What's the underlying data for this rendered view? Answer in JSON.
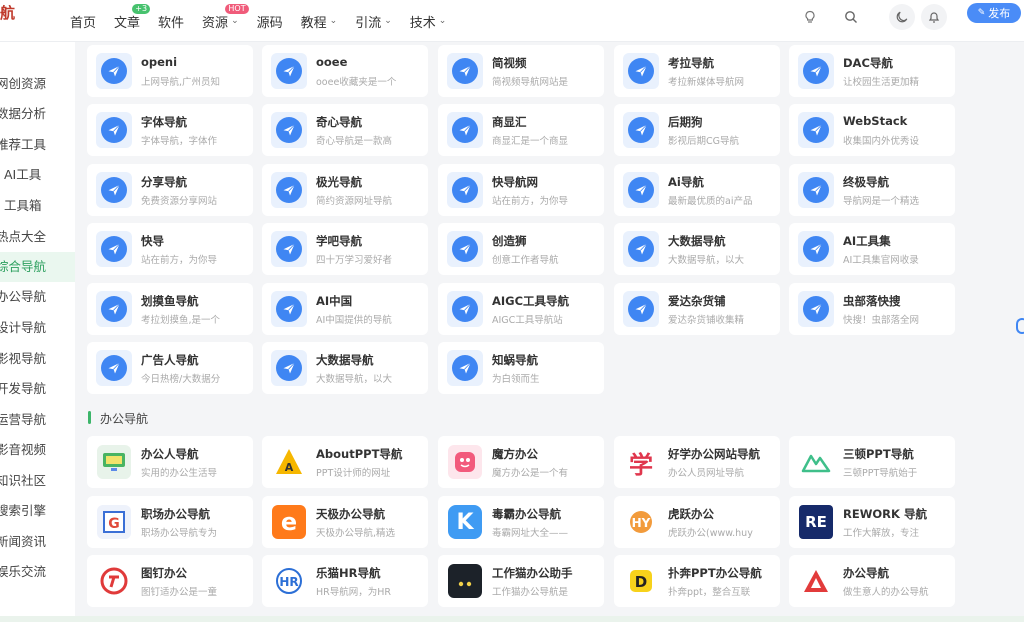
{
  "header": {
    "logo": "航",
    "nav": [
      {
        "label": "首页",
        "chevron": false,
        "badge": ""
      },
      {
        "label": "文章",
        "chevron": false,
        "badge": "+3"
      },
      {
        "label": "软件",
        "chevron": false,
        "badge": ""
      },
      {
        "label": "资源",
        "chevron": true,
        "badge": "HOT"
      },
      {
        "label": "源码",
        "chevron": false,
        "badge": ""
      },
      {
        "label": "教程",
        "chevron": true,
        "badge": ""
      },
      {
        "label": "引流",
        "chevron": true,
        "badge": ""
      },
      {
        "label": "技术",
        "chevron": true,
        "badge": ""
      }
    ],
    "publish_label": "发布",
    "icons": [
      "lightbulb-icon",
      "search-icon",
      "moon-icon",
      "bell-icon"
    ]
  },
  "sidebar": {
    "items": [
      {
        "label": "网创资源",
        "active": false
      },
      {
        "label": "数据分析",
        "active": false
      },
      {
        "label": "推荐工具",
        "active": false
      },
      {
        "label": "AI工具",
        "active": false
      },
      {
        "label": "工具箱",
        "active": false
      },
      {
        "label": "热点大全",
        "active": false
      },
      {
        "label": "综合导航",
        "active": true
      },
      {
        "label": "办公导航",
        "active": false
      },
      {
        "label": "设计导航",
        "active": false
      },
      {
        "label": "影视导航",
        "active": false
      },
      {
        "label": "开发导航",
        "active": false
      },
      {
        "label": "运营导航",
        "active": false
      },
      {
        "label": "影音视频",
        "active": false
      },
      {
        "label": "知识社区",
        "active": false
      },
      {
        "label": "搜索引擎",
        "active": false
      },
      {
        "label": "新闻资讯",
        "active": false
      },
      {
        "label": "娱乐交流",
        "active": false
      }
    ]
  },
  "nav_cards": [
    {
      "title": "openi",
      "desc": "上网导航,广州员知"
    },
    {
      "title": "ooee",
      "desc": "ooee收藏夹是一个"
    },
    {
      "title": "简视频",
      "desc": "简视频导航网站是"
    },
    {
      "title": "考拉导航",
      "desc": "考拉新媒体导航网"
    },
    {
      "title": "DAC导航",
      "desc": "让校园生活更加精"
    },
    {
      "title": "字体导航",
      "desc": "字体导航，字体作"
    },
    {
      "title": "奇心导航",
      "desc": "奇心导航是一款高"
    },
    {
      "title": "商显汇",
      "desc": "商显汇是一个商显"
    },
    {
      "title": "后期狗",
      "desc": "影视后期CG导航"
    },
    {
      "title": "WebStack",
      "desc": "收集国内外优秀设"
    },
    {
      "title": "分享导航",
      "desc": "免费资源分享网站"
    },
    {
      "title": "极光导航",
      "desc": "简约资源网址导航"
    },
    {
      "title": "快导航网",
      "desc": "站在前方，为你导"
    },
    {
      "title": "Ai导航",
      "desc": "最新最优质的ai产品"
    },
    {
      "title": "终极导航",
      "desc": "导航网是一个精选"
    },
    {
      "title": "快导",
      "desc": "站在前方，为你导"
    },
    {
      "title": "学吧导航",
      "desc": "四十万学习爱好者"
    },
    {
      "title": "创造狮",
      "desc": "创意工作者导航"
    },
    {
      "title": "大数据导航",
      "desc": "大数据导航，以大"
    },
    {
      "title": "AI工具集",
      "desc": "AI工具集官网收录"
    },
    {
      "title": "划摸鱼导航",
      "desc": "考拉划摸鱼,是一个"
    },
    {
      "title": "AI中国",
      "desc": "AI中国提供的导航"
    },
    {
      "title": "AIGC工具导航",
      "desc": "AIGC工具导航站"
    },
    {
      "title": "爱达杂货铺",
      "desc": "爱达杂货铺收集精"
    },
    {
      "title": "虫部落快搜",
      "desc": "快搜！虫部落全网"
    },
    {
      "title": "广告人导航",
      "desc": "今日热榜/大数据分"
    },
    {
      "title": "大数据导航",
      "desc": "大数据导航，以大"
    },
    {
      "title": "知蜗导航",
      "desc": "为白领而生"
    }
  ],
  "office_section": {
    "title": "办公导航",
    "cards": [
      {
        "title": "办公人导航",
        "desc": "实用的办公生活导",
        "icon": "monitor-icon"
      },
      {
        "title": "AboutPPT导航",
        "desc": "PPT设计师的网址",
        "icon": "aboutppt-logo-icon"
      },
      {
        "title": "魔方办公",
        "desc": "魔方办公是一个有",
        "icon": "magic-cube-icon"
      },
      {
        "title": "好学办公网站导航",
        "desc": "办公人员网址导航",
        "icon": "xue-char-icon"
      },
      {
        "title": "三顿PPT导航",
        "desc": "三顿PPT导航始于",
        "icon": "mountain-logo-icon"
      },
      {
        "title": "职场办公导航",
        "desc": "职场办公导航专为",
        "icon": "g-letter-icon"
      },
      {
        "title": "天极办公导航",
        "desc": "天极办公导航,精选",
        "icon": "e-letter-icon"
      },
      {
        "title": "毒霸办公导航",
        "desc": "毒霸网址大全——",
        "icon": "k-letter-icon"
      },
      {
        "title": "虎跃办公",
        "desc": "虎跃办公(www.huy",
        "icon": "tiger-logo-icon"
      },
      {
        "title": "REWORK 导航",
        "desc": "工作大解放，专注",
        "icon": "re-letter-icon"
      },
      {
        "title": "图钉办公",
        "desc": "图钉适办公是一童",
        "icon": "pin-logo-icon"
      },
      {
        "title": "乐猫HR导航",
        "desc": "HR导航网，为HR",
        "icon": "hr-logo-icon"
      },
      {
        "title": "工作猫办公助手",
        "desc": "工作猫办公导航是",
        "icon": "cat-icon"
      },
      {
        "title": "扑奔PPT办公导航",
        "desc": "扑奔ppt，整合互联",
        "icon": "p-letter-icon"
      },
      {
        "title": "办公导航",
        "desc": "做生意人的办公导航",
        "icon": "a-logo-icon"
      }
    ]
  },
  "colors": {
    "accent": "#3f86f3",
    "active_green": "#2ea05f",
    "publish": "#4a8cf7"
  }
}
